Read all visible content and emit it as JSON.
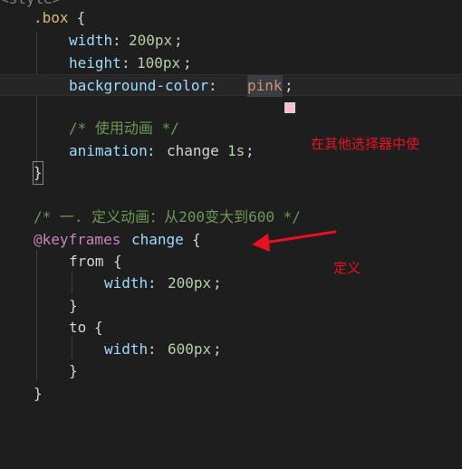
{
  "code": {
    "line_style_tag": "<style>",
    "line_box_selector": ".box",
    "line_box_open": " {",
    "line_width_prop": "width",
    "line_width_val": "200px",
    "line_height_prop": "height",
    "line_height_val": "100px",
    "line_bg_prop": "background-color",
    "line_bg_val": "pink",
    "line_bg_swatch_color": "#ffc0cb",
    "line_comment_use": "/* 使用动画 */",
    "line_anim_prop": "animation",
    "line_anim_name": "change",
    "line_anim_dur": "1s",
    "line_box_close": "}",
    "line_comment_define": "/* 一. 定义动画：从200变大到600 */",
    "line_keyframes_kw": "@keyframes",
    "line_keyframes_name": "change",
    "line_keyframes_open": "{",
    "line_from": "from",
    "line_from_open": "{",
    "line_from_width_prop": "width",
    "line_from_width_val": "200px",
    "line_from_close": "}",
    "line_to": "to",
    "line_to_open": "{",
    "line_to_width_prop": "width",
    "line_to_width_val": "600px",
    "line_to_close": "}",
    "line_keyframes_close": "}"
  },
  "annotations": {
    "use_note": "在其他选择器中使",
    "define_note": "定义",
    "color": "#e81123"
  }
}
